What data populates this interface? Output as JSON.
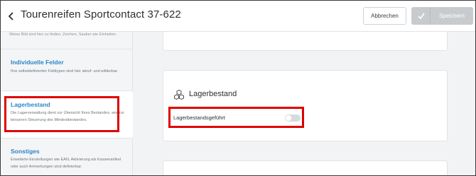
{
  "header": {
    "title": "Tourenreifen Sportcontact 37-622",
    "cancel_label": "Abbrechen",
    "save_label": "Speichern"
  },
  "sidebar": {
    "top_description": "Weise Bild sind hier zu finden, Zeichen, Sauber wie Einheiten.",
    "items": [
      {
        "label": "Individuelle Felder",
        "description": "Ihre selbstdefinierten Feldtypen sind hier abruf- und editierbar."
      },
      {
        "label": "Lagerbestand",
        "description": "Die Lagerverwaltung dient zur Übersicht Ihres Bestandes, wie zur besseren Steuerung des Mindestbestandes."
      },
      {
        "label": "Sonstiges",
        "description": "Erweiterte Einstellungen wie EAN, Aktivierung als Kassenartikel oder auch Anmerkungen sind definierbar."
      }
    ]
  },
  "main": {
    "stock_card": {
      "heading": "Lagerbestand",
      "icon": "boxes-icon",
      "field_label": "Lagerbestandsgeführt",
      "toggle_on": false
    }
  },
  "colors": {
    "accent_link": "#2a86c8",
    "highlight": "#e00000",
    "save_disabled": "#c8cbce"
  }
}
